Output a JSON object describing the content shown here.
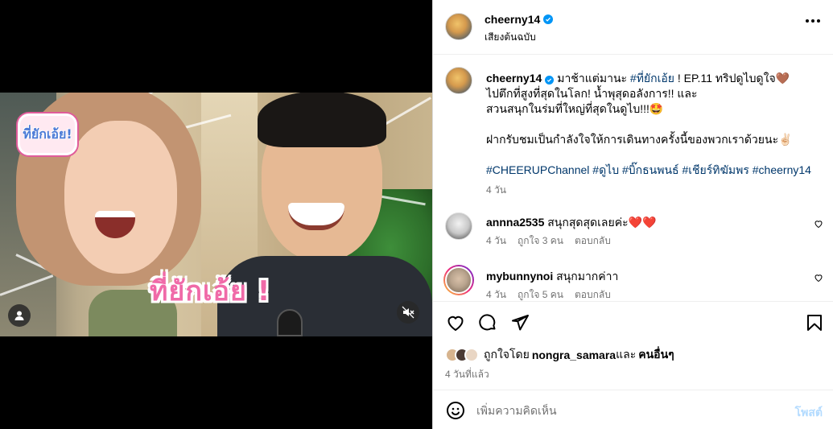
{
  "video": {
    "overlay_title": "ที่ยักเอ้ย !",
    "logo_text": "ที่ยักเอ้ย!",
    "tag_icon": "user-tag-icon",
    "mute_icon": "speaker-muted-icon"
  },
  "header": {
    "username": "cheerny14",
    "audio": "เสียงต้นฉบับ",
    "more_icon": "ellipsis-icon"
  },
  "caption": {
    "username": "cheerny14",
    "line1_pre": "มาช้าแต่มานะ ",
    "line1_tag": "#ที่ยักเอ้ย",
    "line1_post": " ! EP.11 ทริปดูไบดูใจ🤎",
    "line2": "ไปตึกที่สูงที่สุดในโลก! น้ำพุสุดอลังการ!! และ",
    "line3": "สวนสนุกในร่มที่ใหญ่ที่สุดในดูไบ!!!🤩",
    "line4": "ฝากรับชมเป็นกำลังใจให้การเดินทางครั้งนี้ของพวกเราด้วยนะ✌🏻",
    "hashtags": "#CHEERUPChannel #ดูไบ #บิ๊กธนพนธ์ #เชียร์ทิฆัมพร #cheerny14",
    "time": "4 วัน"
  },
  "comments": [
    {
      "username": "annna2535",
      "text": "สนุกสุดสุดเลยค่ะ❤️❤️",
      "time": "4 วัน",
      "likes": "ถูกใจ 3 คน",
      "reply": "ตอบกลับ"
    },
    {
      "username": "mybunnynoi",
      "text": "สนุกมากค่าา",
      "time": "4 วัน",
      "likes": "ถูกใจ 5 คน",
      "reply": "ตอบกลับ"
    }
  ],
  "actions": {
    "like_icon": "heart-icon",
    "comment_icon": "comment-bubble-icon",
    "share_icon": "paper-plane-icon",
    "save_icon": "bookmark-icon"
  },
  "likes": {
    "prefix": "ถูกใจโดย ",
    "user": "nongra_samara",
    "mid": " และ",
    "others": "คนอื่นๆ"
  },
  "posted": "4 วันที่แล้ว",
  "comment_box": {
    "placeholder": "เพิ่มความคิดเห็น",
    "post_label": "โพสต์"
  },
  "colors": {
    "link": "#00376b",
    "verified": "#0095f6",
    "post_disabled": "#b3dbff",
    "muted_text": "#737373"
  }
}
